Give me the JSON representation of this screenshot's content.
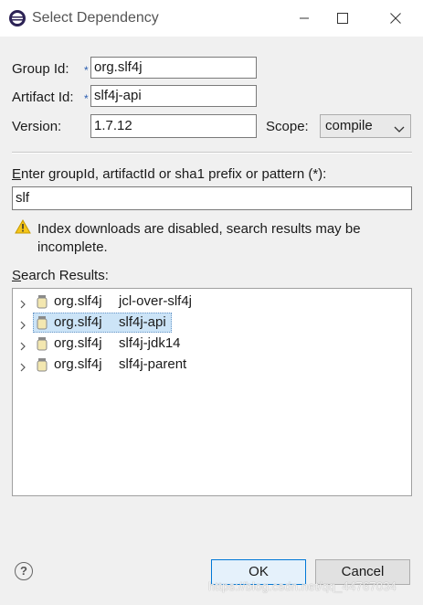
{
  "window": {
    "title": "Select Dependency"
  },
  "form": {
    "group_label": "Group Id:",
    "group_value": "org.slf4j",
    "artifact_label": "Artifact Id:",
    "artifact_value": "slf4j-api",
    "version_label": "Version:",
    "version_value": "1.7.12",
    "scope_label": "Scope:",
    "scope_value": "compile",
    "required_marker": "*"
  },
  "search": {
    "label_mnemonic": "E",
    "label_rest": "nter groupId, artifactId or sha1 prefix or pattern (*):",
    "value": "slf"
  },
  "warning": {
    "text": "Index downloads are disabled, search results may be incomplete."
  },
  "results": {
    "label_mnemonic": "S",
    "label_rest": "earch Results:",
    "items": [
      {
        "group": "org.slf4j",
        "artifact": "jcl-over-slf4j"
      },
      {
        "group": "org.slf4j",
        "artifact": "slf4j-api"
      },
      {
        "group": "org.slf4j",
        "artifact": "slf4j-jdk14"
      },
      {
        "group": "org.slf4j",
        "artifact": "slf4j-parent"
      }
    ],
    "selected_index": 1
  },
  "footer": {
    "help_label": "?",
    "ok_label": "OK",
    "cancel_label": "Cancel",
    "watermark": "https://blog.csdn.net/qq_44767034"
  },
  "colors": {
    "selection": "#cce4f7",
    "default_button_border": "#0078d7",
    "required_marker": "#2a5db0"
  }
}
